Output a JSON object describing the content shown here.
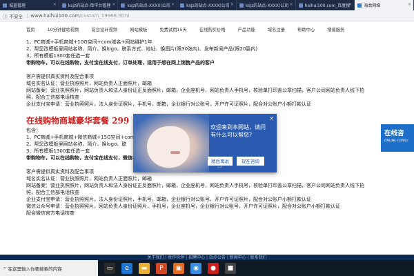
{
  "browser": {
    "tabs": [
      {
        "label": "城盖管理"
      },
      {
        "label": "ksjz的站点-单平台管理"
      },
      {
        "label": "ksjz的站点-XXXX(公司"
      },
      {
        "label": "ksjz的站点-XXXX(公司"
      },
      {
        "label": "ksjz的站点-XXXX(公司"
      },
      {
        "label": "haihui100.com_百度搜"
      },
      {
        "label": "海会网络",
        "active": true
      }
    ],
    "address": {
      "security_label": "不安全",
      "host": "www.haihui100.com",
      "path": "/custom_19968.html"
    }
  },
  "site_nav": {
    "items": [
      "首页",
      "10分钟建站视频",
      "前台设计视频",
      "网站模板",
      "免费试用15天",
      "在线购买价格",
      "产品功能",
      "域名注册",
      "帮助中心",
      "增值服务"
    ]
  },
  "content": {
    "block1": [
      "1、PC商城+手机商城+10G空间+com域名+网站维护1年",
      "2、帮您改模板里网站名称、简介、换logo、联系方式、地址、换图片(限30张内)、发布新闻产品(限20篇内)",
      "3、所有模板1300套任选一套"
    ],
    "block1_bold": "带购物车，可以在线购物，支付宝在线支付，订单处理，适用于想在网上销售产品的客户",
    "block2": [
      "客户需提供真实资料及配合事项",
      "域名实名认证：营业执照照片，网站负责人正面照片，邮箱",
      "网站备案：营业执照照片，网站负责人和法人身份证正反面照片，邮箱，企业座机号，网站负责人手机号，核验单打印盖公章扫描，客户公司网站负责人线下拍",
      "照，配合工信部电话核查",
      "企业支付宝申请：营业执照照片，法人身份证照片，手机号，邮箱，企业银行对公账号，开户许可证照片，配合对公账户小额打款认证"
    ],
    "big_title": "在线购物商城豪华套餐  299",
    "block3_head": "包含：",
    "block3": [
      "1、PC商城+手机商城+微信商城+15G空间+com",
      "2、帮您改模板里网站名称、简介、换logo、联",
      "3、所有模板1300套任选一套"
    ],
    "block3_bold": "带购物车，可以在线购物，支付宝在线支付，微信在线支付，订单处理，适用于想在网上销售产品的客户",
    "block4": [
      "客户需提供真实资料及配合事项",
      "域名实名认证：营业执照照片，网站负责人正面照片，邮箱",
      "网站备案：营业执照照片，网站负责人和法人身份证正反面照片，邮箱，企业座机号，网站负责人手机号，核验单打印盖公章扫描，客户公司网站负责人线下拍",
      "照，配合工信部电话核查",
      "企业支付宝申请：营业执照照片，法人身份证照片，手机号，邮箱，企业银行对公账号，开户许可证照片，配合对公账户小额打款认证",
      "微信公众号申请：营业执照照片，网站负责人身份证照片，手机号，企业座机号，企业银行对公账号，开户许可证照片，配合对公账户小额打款认证",
      "配合微信官方电话核查"
    ]
  },
  "popup": {
    "message": "欢迎来到本网站，请问有什么可以帮您?",
    "later_label": "稍后再说",
    "now_label": "现在咨询",
    "close_glyph": "×"
  },
  "side_banner": {
    "big": "在线咨",
    "small": "ONLINE CONSU"
  },
  "footer": {
    "text": "关于我们 | 合作伙伴 | 招聘中心 | 站点公告 | 新闻中心 | 联系我们"
  },
  "taskbar": {
    "search_placeholder": "在这里输入你要搜索的内容",
    "icons": [
      {
        "name": "task-view-icon",
        "color": "#2b2b2b",
        "glyph": "▭"
      },
      {
        "name": "edge-icon",
        "color": "#1c75d3",
        "glyph": "e"
      },
      {
        "name": "folder-icon",
        "color": "#e8b13a",
        "glyph": "▬"
      },
      {
        "name": "powerpoint-icon",
        "color": "#d24726",
        "glyph": "P"
      },
      {
        "name": "photos-icon",
        "color": "#e36a1e",
        "glyph": "▣"
      },
      {
        "name": "browser-icon",
        "color": "#3a8de0",
        "glyph": "◉"
      },
      {
        "name": "record-icon",
        "color": "#c81e1e",
        "glyph": "●"
      },
      {
        "name": "app-icon",
        "color": "#444",
        "glyph": "■"
      }
    ]
  }
}
